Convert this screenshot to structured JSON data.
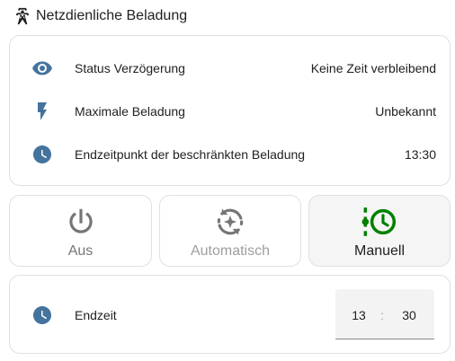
{
  "header": {
    "icon": "transmission-tower-icon",
    "title": "Netzdienliche Beladung"
  },
  "info_rows": [
    {
      "icon": "eye-icon",
      "label": "Status Verzögerung",
      "value": "Keine Zeit verbleibend"
    },
    {
      "icon": "flash-icon",
      "label": "Maximale Beladung",
      "value": "Unbekannt"
    },
    {
      "icon": "clock-icon",
      "label": "Endzeitpunkt der beschränkten Beladung",
      "value": "13:30"
    }
  ],
  "mode_buttons": [
    {
      "icon": "power-icon",
      "label": "Aus",
      "active": false
    },
    {
      "icon": "auto-mode-icon",
      "label": "Automatisch",
      "active": false
    },
    {
      "icon": "clock-manual-icon",
      "label": "Manuell",
      "active": true
    }
  ],
  "end_time": {
    "icon": "clock-icon",
    "label": "Endzeit",
    "hours": "13",
    "separator": ":",
    "minutes": "30"
  },
  "colors": {
    "icon_blue": "#44739e",
    "active_green": "#008000",
    "inactive_gray": "#757575"
  }
}
